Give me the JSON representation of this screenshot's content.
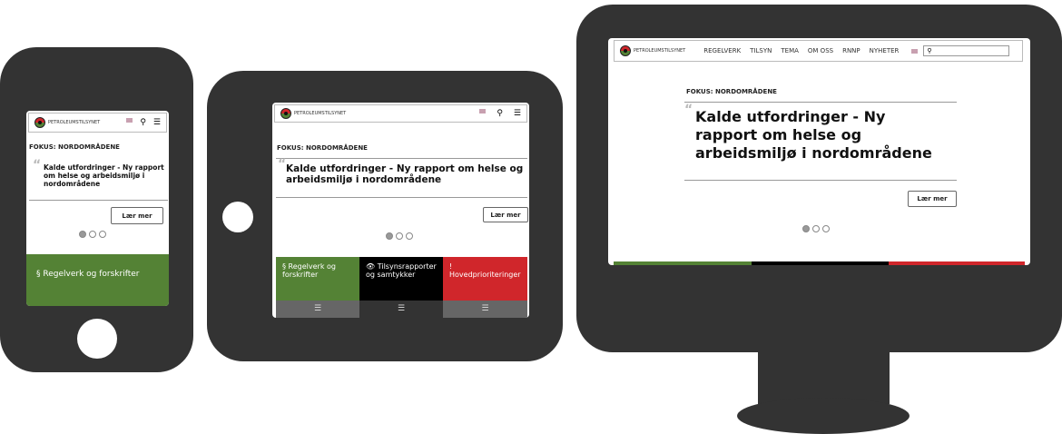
{
  "site": {
    "logo_text": "PETROLEUMSTILSYNET",
    "nav": [
      "REGELVERK",
      "TILSYN",
      "TEMA",
      "OM OSS",
      "RNNP",
      "NYHETER"
    ],
    "search_placeholder": ""
  },
  "focus": "FOKUS: NORDOMRÅDENE",
  "headline": "Kalde utfordringer - Ny rapport om helse og arbeidsmiljø i nordområdene",
  "learn_more": "Lær mer",
  "carousel": {
    "count": 3,
    "active": 1
  },
  "tiles": [
    {
      "icon": "§",
      "label": "Regelverk og forskrifter",
      "color": "#548235"
    },
    {
      "icon": "👁",
      "label": "Tilsynsrapporter og samtykker",
      "color": "#000000"
    },
    {
      "icon": "!",
      "label": "Hovedprioriteringer",
      "color": "#d0262b"
    }
  ],
  "colors": {
    "device": "#333333"
  }
}
